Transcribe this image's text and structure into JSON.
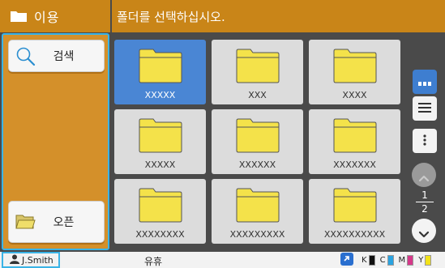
{
  "header": {
    "title": "이용",
    "message": "폴더를 선택하십시오."
  },
  "sidebar": {
    "search_label": "검색",
    "open_label": "오픈"
  },
  "folders": [
    {
      "name": "XXXXX",
      "selected": true
    },
    {
      "name": "XXX",
      "selected": false
    },
    {
      "name": "XXXX",
      "selected": false
    },
    {
      "name": "XXXXX",
      "selected": false
    },
    {
      "name": "XXXXXX",
      "selected": false
    },
    {
      "name": "XXXXXXX",
      "selected": false
    },
    {
      "name": "XXXXXXXX",
      "selected": false
    },
    {
      "name": "XXXXXXXXX",
      "selected": false
    },
    {
      "name": "XXXXXXXXXX",
      "selected": false
    }
  ],
  "pagination": {
    "current": "1",
    "total": "2"
  },
  "status": {
    "user": "J.Smith",
    "state": "유휴",
    "inks": [
      {
        "label": "K",
        "color": "#111111",
        "level": 1.0
      },
      {
        "label": "C",
        "color": "#2aa3e0",
        "level": 1.0
      },
      {
        "label": "M",
        "color": "#d6388a",
        "level": 1.0
      },
      {
        "label": "Y",
        "color": "#f2e21a",
        "level": 1.0
      }
    ]
  },
  "colors": {
    "accent": "#c98518",
    "selection": "#4a86d4",
    "focus": "#3ab3e6",
    "folder": "#f4e24a"
  }
}
